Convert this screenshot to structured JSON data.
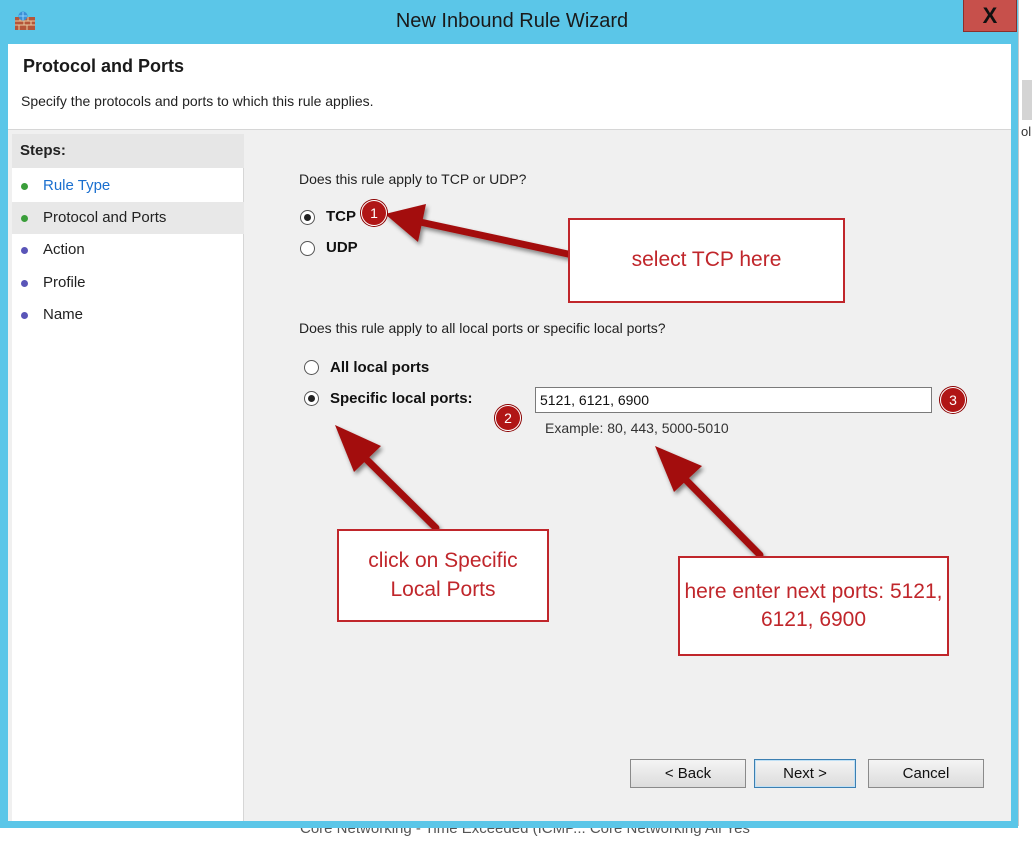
{
  "window": {
    "title": "New Inbound Rule Wizard",
    "close_label": "X"
  },
  "header": {
    "title": "Protocol and Ports",
    "subtitle": "Specify the protocols and ports to which this rule applies."
  },
  "steps": {
    "label": "Steps:",
    "items": [
      {
        "label": "Rule Type",
        "status": "done"
      },
      {
        "label": "Protocol and Ports",
        "status": "current"
      },
      {
        "label": "Action",
        "status": "pending"
      },
      {
        "label": "Profile",
        "status": "pending"
      },
      {
        "label": "Name",
        "status": "pending"
      }
    ]
  },
  "protocol": {
    "question": "Does this rule apply to TCP or UDP?",
    "tcp_label": "TCP",
    "udp_label": "UDP",
    "selected": "TCP"
  },
  "ports": {
    "question": "Does this rule apply to all local ports or specific local ports?",
    "all_label": "All local ports",
    "specific_label": "Specific local ports:",
    "selected": "specific",
    "value": "5121, 6121, 6900",
    "example": "Example: 80, 443, 5000-5010"
  },
  "buttons": {
    "back": "< Back",
    "next": "Next >",
    "cancel": "Cancel"
  },
  "annotations": {
    "badge1": "1",
    "badge2": "2",
    "badge3": "3",
    "callout_tcp": "select TCP here",
    "callout_specific": "click on Specific Local Ports",
    "callout_ports": "here enter next ports: 5121, 6121, 6900",
    "color": "#c0262b"
  },
  "background": {
    "peek_text": "ol",
    "row_text": "Core Networking - Time Exceeded (ICMP...   Core Networking          All          Yes"
  },
  "colors": {
    "titlebar": "#5bc6e8",
    "close_button": "#c7504b",
    "link": "#1a6fcf"
  }
}
